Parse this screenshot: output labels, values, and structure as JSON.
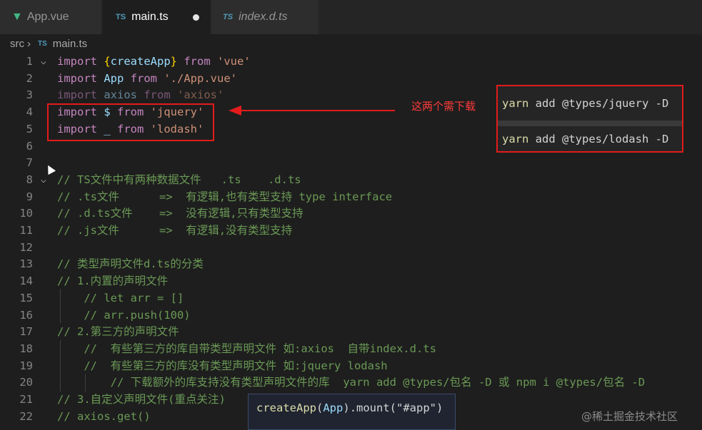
{
  "tabs": [
    {
      "label": "App.vue",
      "icon": "vue-icon"
    },
    {
      "label": "main.ts",
      "icon": "ts-icon",
      "badge": "TS"
    },
    {
      "label": "index.d.ts",
      "icon": "ts-icon",
      "badge": "TS"
    }
  ],
  "breadcrumb": {
    "folder": "src",
    "badge": "TS",
    "file": "main.ts"
  },
  "lines": [
    {
      "n": "1",
      "parts": [
        "import",
        " {",
        "createApp",
        "} ",
        "from",
        " 'vue'"
      ]
    },
    {
      "n": "2",
      "parts": [
        "import",
        " App ",
        "from",
        " './App.vue'"
      ]
    },
    {
      "n": "3",
      "parts": [
        "import",
        " axios ",
        "from",
        " 'axios'"
      ]
    },
    {
      "n": "4",
      "parts": [
        "import",
        " $ ",
        "from",
        " 'jquery'"
      ]
    },
    {
      "n": "5",
      "parts": [
        "import",
        " _ ",
        "from",
        " 'lodash'"
      ]
    },
    {
      "n": "6"
    },
    {
      "n": "7"
    },
    {
      "n": "8",
      "text": "// TS文件中有两种数据文件   .ts    .d.ts"
    },
    {
      "n": "9",
      "text": "// .ts文件      =>  有逻辑,也有类型支持 type interface"
    },
    {
      "n": "10",
      "text": "// .d.ts文件    =>  没有逻辑,只有类型支持"
    },
    {
      "n": "11",
      "text": "// .js文件      =>  有逻辑,没有类型支持"
    },
    {
      "n": "12"
    },
    {
      "n": "13",
      "text": "// 类型声明文件d.ts的分类"
    },
    {
      "n": "14",
      "text": "// 1.内置的声明文件"
    },
    {
      "n": "15",
      "text": "    // let arr = []"
    },
    {
      "n": "16",
      "text": "    // arr.push(100)"
    },
    {
      "n": "17",
      "text": "// 2.第三方的声明文件"
    },
    {
      "n": "18",
      "text": "    //  有些第三方的库自带类型声明文件 如:axios  自带index.d.ts"
    },
    {
      "n": "19",
      "text": "    //  有些第三方的库没有类型声明文件 如:jquery lodash"
    },
    {
      "n": "20",
      "text": "        // 下载额外的库支持没有类型声明文件的库  yarn add @types/包名 -D 或 npm i @types/包名 -D"
    },
    {
      "n": "21",
      "text": "// 3.自定义声明文件(重点关注)"
    },
    {
      "n": "22",
      "text": "// axios.get()"
    }
  ],
  "popup": {
    "cmd1": [
      "yarn",
      " add @types/jquery -D"
    ],
    "cmd2": [
      "yarn",
      " add @types/lodash -D"
    ]
  },
  "note": "这两个需下载",
  "tooltip": {
    "fn": "createApp",
    "arg": "App",
    "rest": ".mount(\"#app\")"
  },
  "watermark": "@稀土掘金技术社区",
  "colors": {
    "keyword": "#c586c0",
    "string": "#ce9178",
    "comment": "#6a9955",
    "annotation": "#e31b1b"
  }
}
